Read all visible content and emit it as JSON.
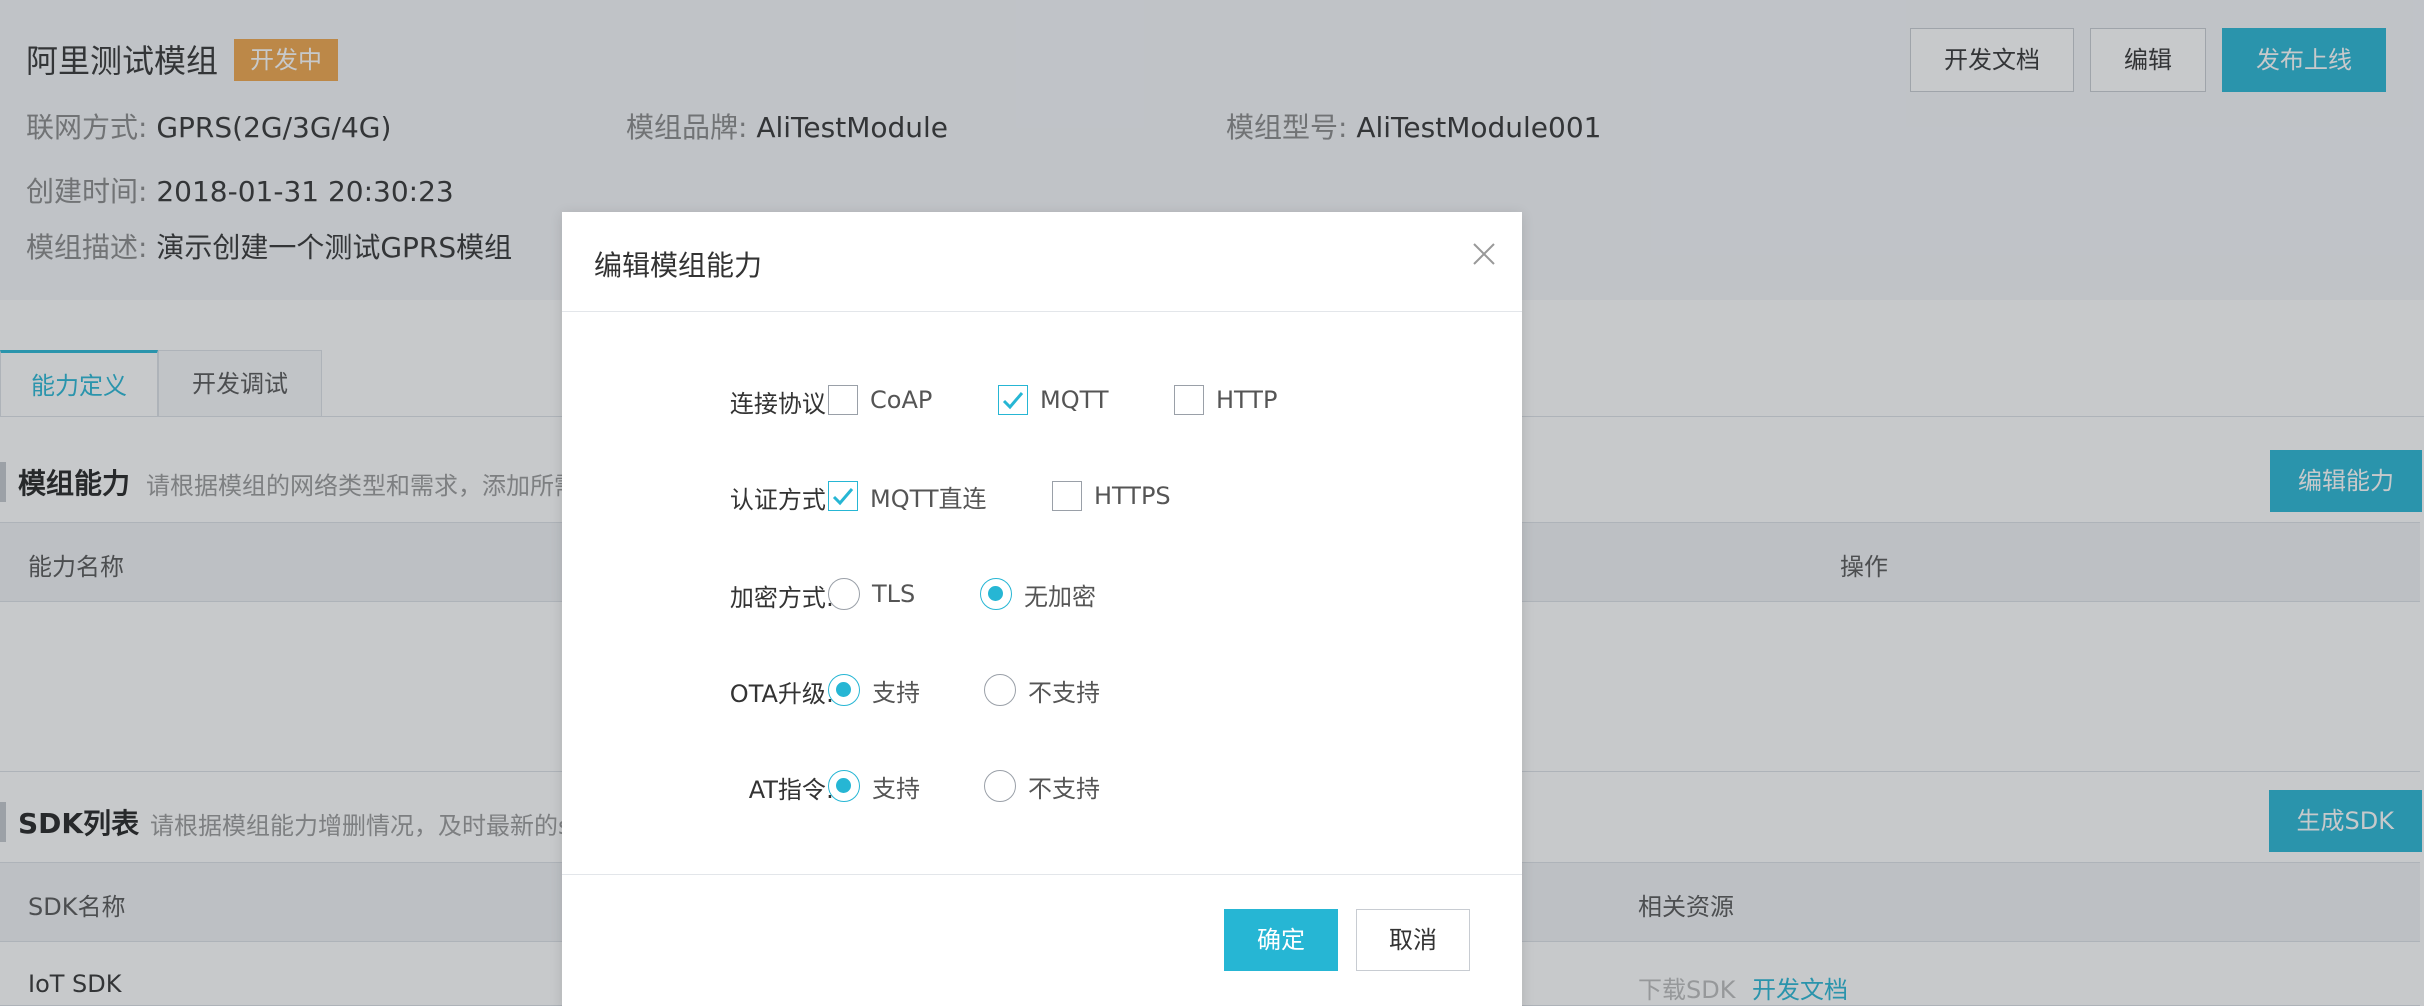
{
  "header": {
    "module_title": "阿里测试模组",
    "status_badge": "开发中",
    "buttons": {
      "docs": "开发文档",
      "edit": "编辑",
      "publish": "发布上线"
    },
    "info": {
      "network_label": "联网方式:",
      "network_value": "GPRS(2G/3G/4G)",
      "brand_label": "模组品牌:",
      "brand_value": "AliTestModule",
      "model_label": "模组型号:",
      "model_value": "AliTestModule001",
      "created_label": "创建时间:",
      "created_value": "2018-01-31 20:30:23",
      "desc_label": "模组描述:",
      "desc_value": "演示创建一个测试GPRS模组"
    }
  },
  "tabs": [
    {
      "label": "能力定义",
      "active": true
    },
    {
      "label": "开发调试",
      "active": false
    }
  ],
  "capability_section": {
    "title": "模组能力",
    "desc": "请根据模组的网络类型和需求，添加所需",
    "button": "编辑能力",
    "columns": {
      "name": "能力名称",
      "action": "操作"
    }
  },
  "sdk_section": {
    "title": "SDK列表",
    "desc": "请根据模组能力增删情况，及时最新的s",
    "button": "生成SDK",
    "columns": {
      "name": "SDK名称",
      "resources": "相关资源"
    },
    "rows": [
      {
        "name": "IoT SDK",
        "download": "下载SDK",
        "docs": "开发文档"
      }
    ]
  },
  "modal": {
    "title": "编辑模组能力",
    "rows": [
      {
        "label": "连接协议:",
        "type": "checkbox",
        "options": [
          {
            "label": "CoAP",
            "checked": false
          },
          {
            "label": "MQTT",
            "checked": true
          },
          {
            "label": "HTTP",
            "checked": false
          }
        ]
      },
      {
        "label": "认证方式:",
        "type": "checkbox",
        "options": [
          {
            "label": "MQTT直连",
            "checked": true
          },
          {
            "label": "HTTPS",
            "checked": false
          }
        ]
      },
      {
        "label": "加密方式:",
        "type": "radio",
        "options": [
          {
            "label": "TLS",
            "checked": false
          },
          {
            "label": "无加密",
            "checked": true
          }
        ]
      },
      {
        "label": "OTA升级:",
        "type": "radio",
        "options": [
          {
            "label": "支持",
            "checked": true
          },
          {
            "label": "不支持",
            "checked": false
          }
        ]
      },
      {
        "label": "AT指令:",
        "type": "radio",
        "options": [
          {
            "label": "支持",
            "checked": true
          },
          {
            "label": "不支持",
            "checked": false
          }
        ]
      }
    ],
    "ok_label": "确定",
    "cancel_label": "取消"
  },
  "colors": {
    "accent": "#26b6d4",
    "status_badge": "#f0a64a",
    "overlay": "rgba(55,60,70,0.28)"
  },
  "icons": {
    "close": "close-icon",
    "check": "check-icon"
  }
}
